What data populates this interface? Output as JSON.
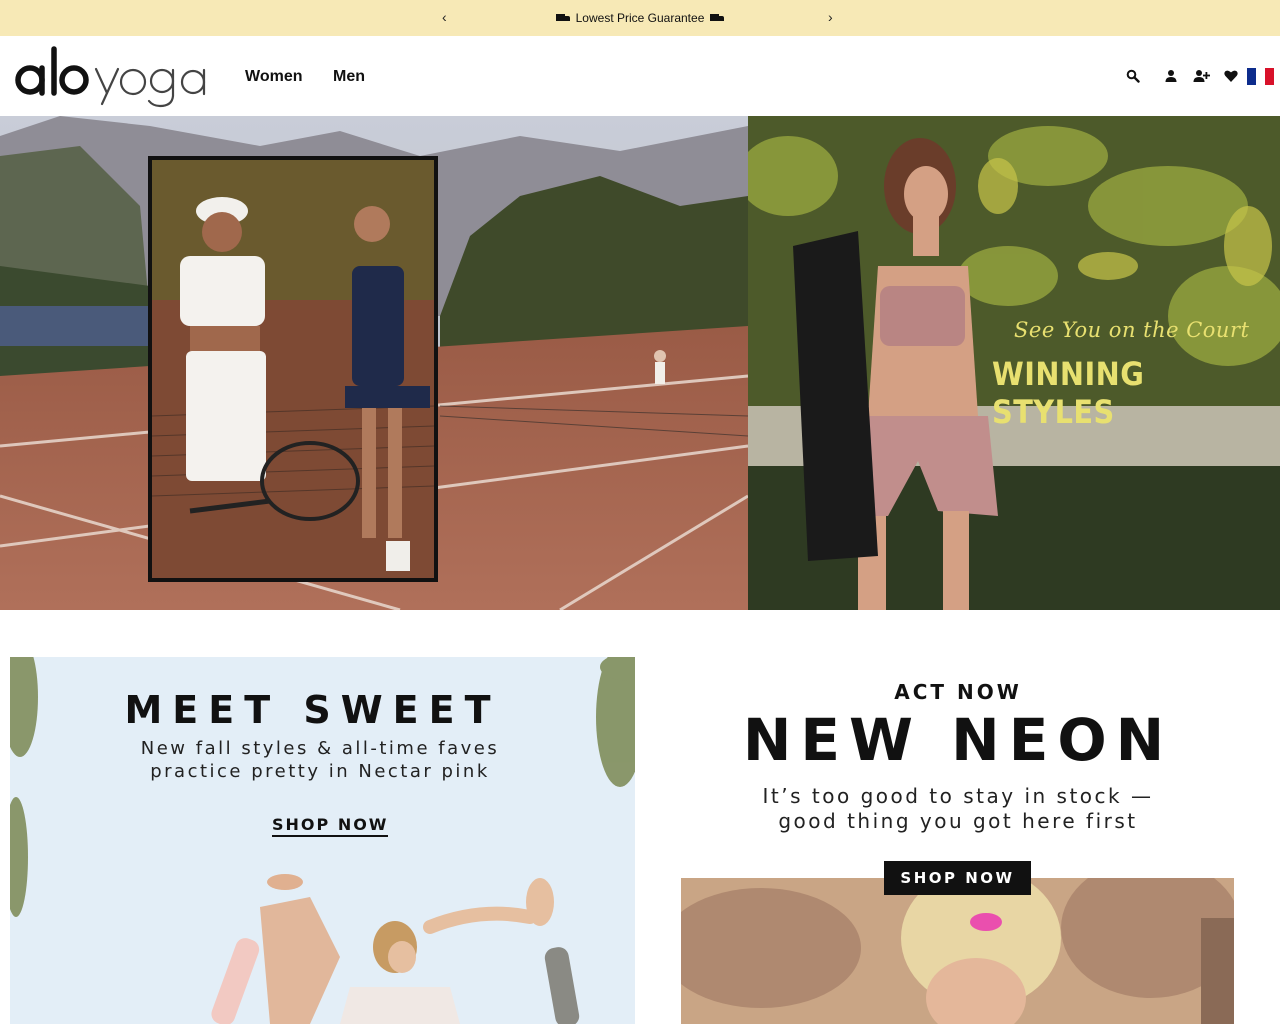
{
  "announcement": {
    "prev_icon": "chevron-left-icon",
    "next_icon": "chevron-right-icon",
    "prev_label": "‹",
    "next_label": "›",
    "message": "Lowest Price Guarantee",
    "icon": "truck-icon"
  },
  "header": {
    "logo_text": "alo yoga",
    "nav": [
      {
        "label": "Women"
      },
      {
        "label": "Men"
      }
    ],
    "icons": [
      "search-icon",
      "account-icon",
      "add-user-icon",
      "heart-icon",
      "france-flag-icon"
    ]
  },
  "hero": {
    "tagline": "See You on the Court",
    "title": "WINNING STYLES"
  },
  "promo_left": {
    "title": "MEET SWEET",
    "subtitle_line1": "New fall styles & all-time faves",
    "subtitle_line2": "practice pretty in Nectar pink",
    "cta": "SHOP NOW"
  },
  "promo_right": {
    "kicker": "ACT NOW",
    "title": "NEW NEON",
    "subtitle_line1": "It’s too good to stay in stock —",
    "subtitle_line2": "good thing you got here first",
    "cta": "SHOP NOW"
  },
  "colors": {
    "announcement_bg": "#f7e9b6",
    "hero_text": "#e8e070",
    "text_dark": "#111111"
  }
}
